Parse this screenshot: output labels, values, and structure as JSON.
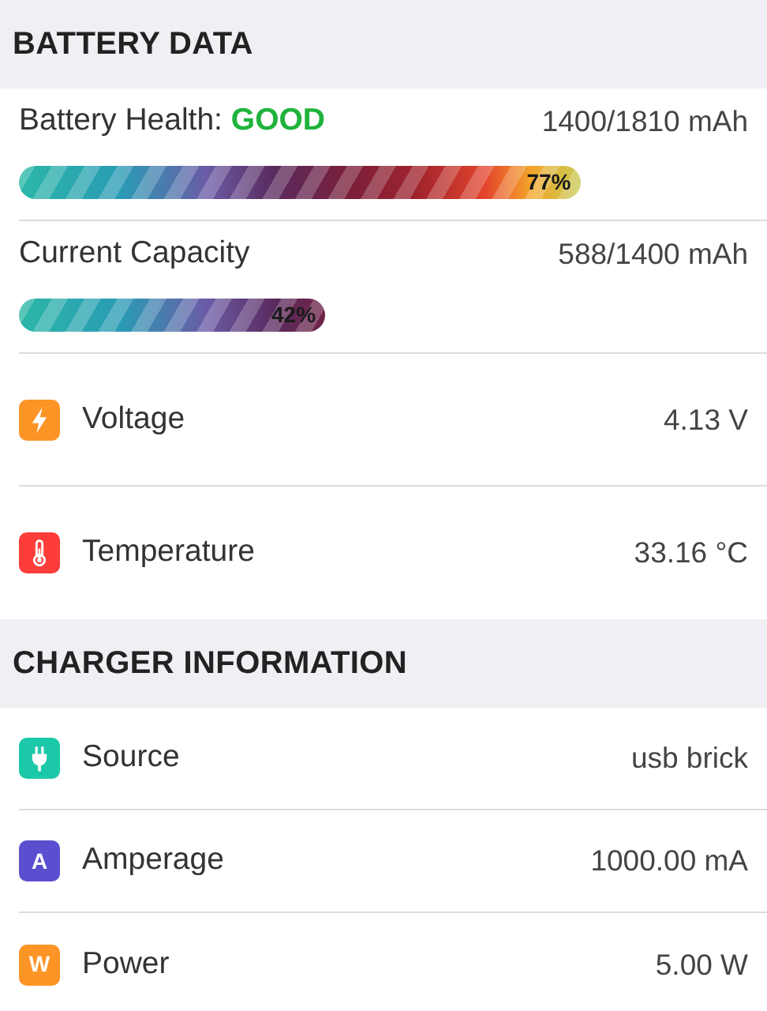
{
  "sections": [
    {
      "title": "BATTERY DATA",
      "rows": [
        {
          "kind": "meter",
          "label": "Battery Health:",
          "status": "GOOD",
          "value": "1400/1810 mAh",
          "level": 0.77,
          "percent": "77%"
        },
        {
          "kind": "meter",
          "label": "Current Capacity",
          "value": "588/1400 mAh",
          "level": 0.42,
          "percent": "42%"
        },
        {
          "kind": "bolt",
          "color": "#fd9426",
          "label": "Voltage",
          "value": "4.13 V"
        },
        {
          "kind": "thermometer",
          "color": "#fc3d39",
          "label": "Temperature",
          "value": "33.16 °C"
        }
      ]
    },
    {
      "title": "CHARGER INFORMATION",
      "rows": [
        {
          "kind": "plug",
          "color": "#1bc9a9",
          "label": "Source",
          "value": "usb brick"
        },
        {
          "kind": "letter",
          "letter": "A",
          "color": "#5a4fcf",
          "label": "Amperage",
          "value": "1000.00 mA"
        },
        {
          "kind": "letter",
          "letter": "W",
          "color": "#fd9426",
          "label": "Power",
          "value": "5.00 W"
        }
      ]
    }
  ]
}
